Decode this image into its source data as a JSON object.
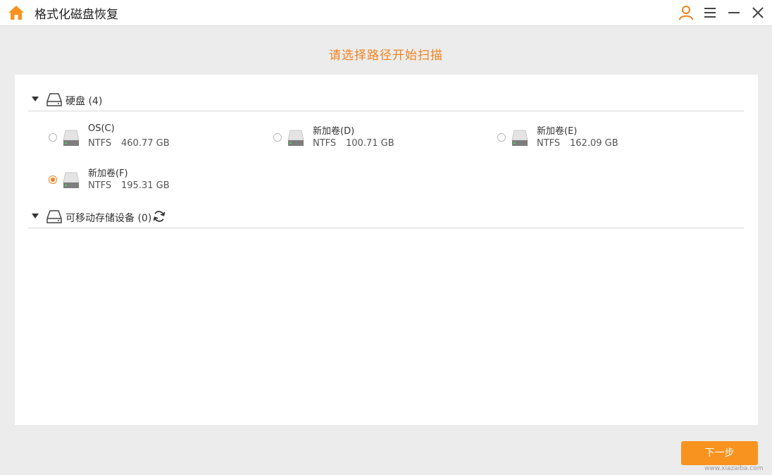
{
  "app": {
    "title": "格式化磁盘恢复"
  },
  "prompt": "请选择路径开始扫描",
  "hard_disks": {
    "label": "硬盘 (4)",
    "drives": [
      {
        "name": "OS(C)",
        "fs": "NTFS",
        "size": "460.77 GB",
        "selected": false
      },
      {
        "name": "新加卷(D)",
        "fs": "NTFS",
        "size": "100.71 GB",
        "selected": false
      },
      {
        "name": "新加卷(E)",
        "fs": "NTFS",
        "size": "162.09 GB",
        "selected": false
      },
      {
        "name": "新加卷(F)",
        "fs": "NTFS",
        "size": "195.31 GB",
        "selected": true
      }
    ]
  },
  "removable": {
    "label": "可移动存储设备 (0)"
  },
  "next_button": "下一步",
  "watermark": "www.xiazaiba.com",
  "colors": {
    "accent": "#f0821e",
    "button": "#f7931e",
    "background": "#ececec"
  },
  "icons": [
    "home-icon",
    "user-icon",
    "menu-icon",
    "minimize-icon",
    "close-icon",
    "drive-icon",
    "refresh-icon"
  ]
}
